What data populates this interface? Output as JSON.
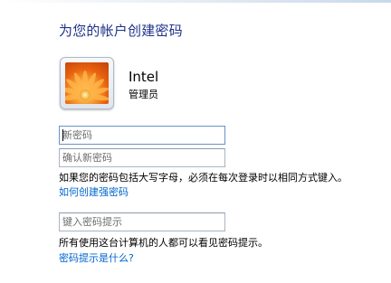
{
  "page": {
    "title": "为您的帐户创建密码"
  },
  "user": {
    "name": "Intel",
    "role": "管理员",
    "avatar": "orange-flower-picture"
  },
  "fields": {
    "new_password": {
      "value": "",
      "placeholder": "新密码"
    },
    "confirm_password": {
      "value": "",
      "placeholder": "确认新密码"
    },
    "password_hint": {
      "value": "",
      "placeholder": "键入密码提示"
    }
  },
  "notes": {
    "case_sensitive": "如果您的密码包括大写字母，必须在每次登录时以相同方式键入。",
    "hint_visibility": "所有使用这台计算机的人都可以看见密码提示。"
  },
  "links": {
    "strong_password": "如何创建强密码",
    "what_is_hint": "密码提示是什么?"
  },
  "colors": {
    "title": "#1e3287",
    "link": "#0066cc"
  }
}
